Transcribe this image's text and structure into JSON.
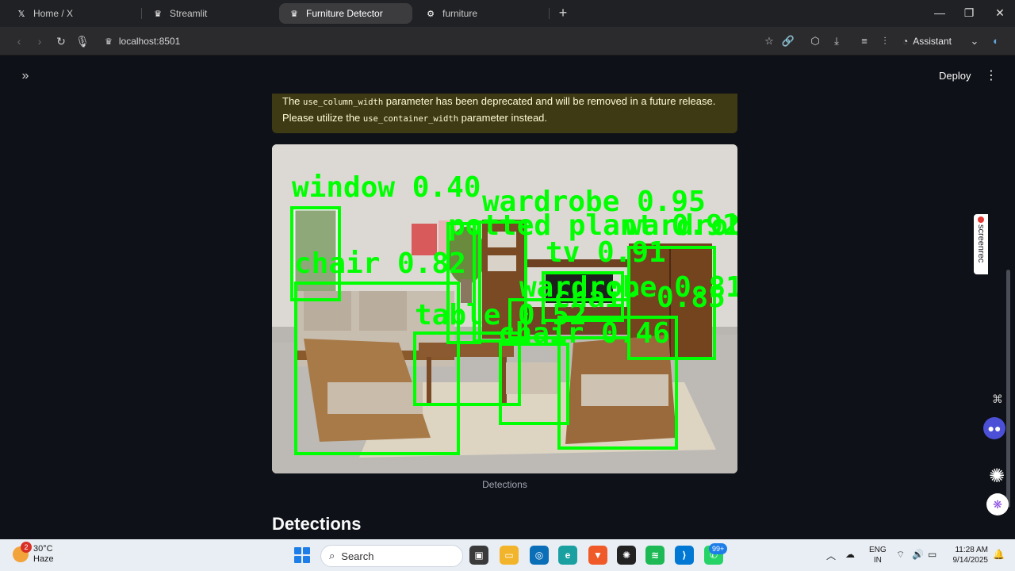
{
  "browser": {
    "tabs": [
      {
        "label": "Home / X",
        "icon": "x-logo-icon"
      },
      {
        "label": "Streamlit",
        "icon": "streamlit-icon"
      },
      {
        "label": "Furniture Detector",
        "icon": "streamlit-icon",
        "active": true
      },
      {
        "label": "furniture",
        "icon": "roboflow-icon"
      }
    ],
    "url": "localhost:8501",
    "assistant_label": "Assistant"
  },
  "app": {
    "deploy_label": "Deploy",
    "warning": {
      "part1": "The ",
      "code1": "use_column_width",
      "part2": " parameter has been deprecated and will be removed in a future release. Please utilize the ",
      "code2": "use_container_width",
      "part3": " parameter instead."
    },
    "image_caption": "Detections",
    "section_heading": "Detections",
    "detections": [
      {
        "label": "window 0.40"
      },
      {
        "label": "wardrobe 0.95"
      },
      {
        "label": "potted plant 0.92"
      },
      {
        "label": "wardrob"
      },
      {
        "label": "tv 0.91"
      },
      {
        "label": "chair 0.82"
      },
      {
        "label": "wardrobe 0.81"
      },
      {
        "label": "chair 0.85"
      },
      {
        "label": "table 0.52"
      },
      {
        "label": "chair 0.46"
      }
    ]
  },
  "side_widgets": {
    "screenrec_label": "screenrec"
  },
  "taskbar": {
    "weather_temp": "30°C",
    "weather_desc": "Haze",
    "weather_badge": "2",
    "search_label": "Search",
    "whatsapp_badge": "99+",
    "language_line1": "ENG",
    "language_line2": "IN",
    "time": "11:28 AM",
    "date": "9/14/2025"
  },
  "colors": {
    "detection_box": "#00ff00",
    "warning_bg": "#3d3a14",
    "page_bg": "#0e1117"
  }
}
